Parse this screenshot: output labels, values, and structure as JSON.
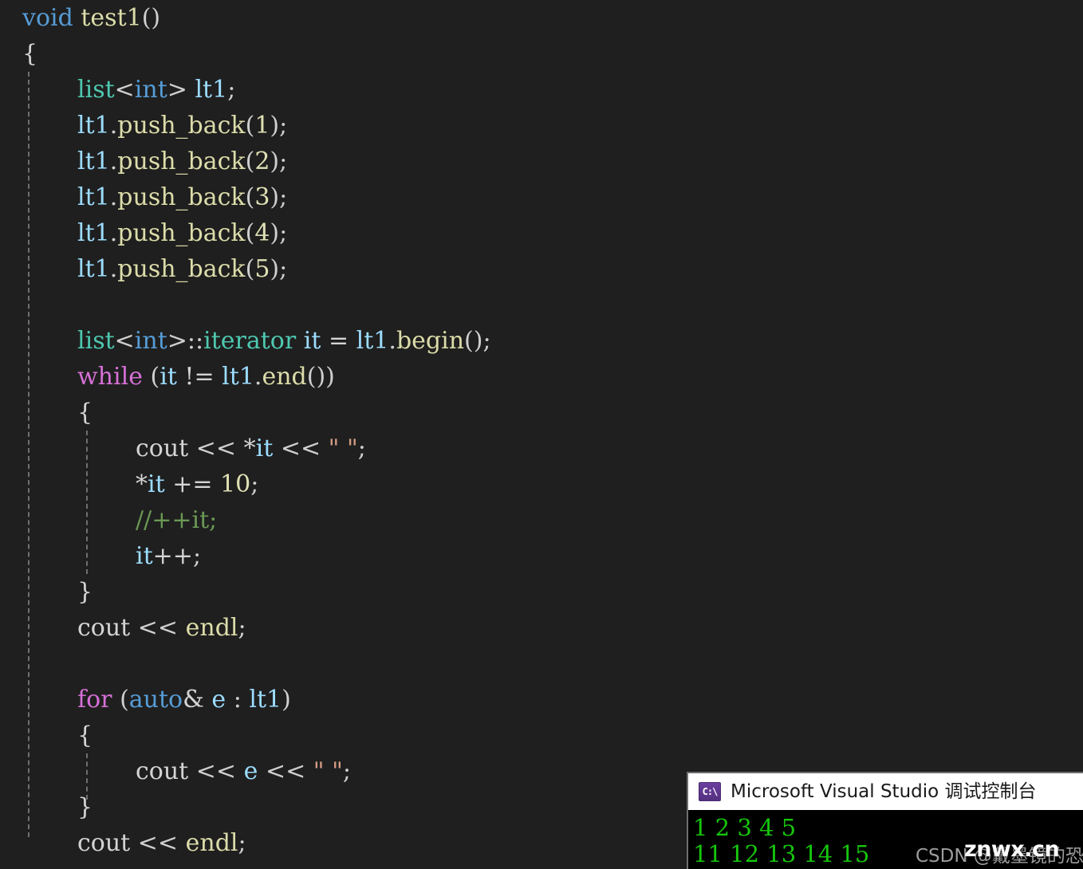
{
  "editor": {
    "background": "#1f1f1f",
    "lines": [
      {
        "indent": 0,
        "tokens": [
          {
            "t": "void",
            "c": "kw"
          },
          {
            "t": " ",
            "c": "plain"
          },
          {
            "t": "test1",
            "c": "fn"
          },
          {
            "t": "()",
            "c": "punct"
          }
        ]
      },
      {
        "indent": 0,
        "tokens": [
          {
            "t": "{",
            "c": "brace"
          }
        ]
      },
      {
        "indent": 1,
        "tokens": [
          {
            "t": "list",
            "c": "type"
          },
          {
            "t": "<",
            "c": "punct"
          },
          {
            "t": "int",
            "c": "kw"
          },
          {
            "t": ">",
            "c": "punct"
          },
          {
            "t": " ",
            "c": "plain"
          },
          {
            "t": "lt1",
            "c": "var"
          },
          {
            "t": ";",
            "c": "punct"
          }
        ]
      },
      {
        "indent": 1,
        "tokens": [
          {
            "t": "lt1",
            "c": "var"
          },
          {
            "t": ".",
            "c": "punct"
          },
          {
            "t": "push_back",
            "c": "fn"
          },
          {
            "t": "(",
            "c": "punct"
          },
          {
            "t": "1",
            "c": "num"
          },
          {
            "t": ")",
            "c": "punct"
          },
          {
            "t": ";",
            "c": "punct"
          }
        ]
      },
      {
        "indent": 1,
        "tokens": [
          {
            "t": "lt1",
            "c": "var"
          },
          {
            "t": ".",
            "c": "punct"
          },
          {
            "t": "push_back",
            "c": "fn"
          },
          {
            "t": "(",
            "c": "punct"
          },
          {
            "t": "2",
            "c": "num"
          },
          {
            "t": ")",
            "c": "punct"
          },
          {
            "t": ";",
            "c": "punct"
          }
        ]
      },
      {
        "indent": 1,
        "tokens": [
          {
            "t": "lt1",
            "c": "var"
          },
          {
            "t": ".",
            "c": "punct"
          },
          {
            "t": "push_back",
            "c": "fn"
          },
          {
            "t": "(",
            "c": "punct"
          },
          {
            "t": "3",
            "c": "num"
          },
          {
            "t": ")",
            "c": "punct"
          },
          {
            "t": ";",
            "c": "punct"
          }
        ]
      },
      {
        "indent": 1,
        "tokens": [
          {
            "t": "lt1",
            "c": "var"
          },
          {
            "t": ".",
            "c": "punct"
          },
          {
            "t": "push_back",
            "c": "fn"
          },
          {
            "t": "(",
            "c": "punct"
          },
          {
            "t": "4",
            "c": "num"
          },
          {
            "t": ")",
            "c": "punct"
          },
          {
            "t": ";",
            "c": "punct"
          }
        ]
      },
      {
        "indent": 1,
        "tokens": [
          {
            "t": "lt1",
            "c": "var"
          },
          {
            "t": ".",
            "c": "punct"
          },
          {
            "t": "push_back",
            "c": "fn"
          },
          {
            "t": "(",
            "c": "punct"
          },
          {
            "t": "5",
            "c": "num"
          },
          {
            "t": ")",
            "c": "punct"
          },
          {
            "t": ";",
            "c": "punct"
          }
        ]
      },
      {
        "indent": 0,
        "tokens": []
      },
      {
        "indent": 1,
        "tokens": [
          {
            "t": "list",
            "c": "type"
          },
          {
            "t": "<",
            "c": "punct"
          },
          {
            "t": "int",
            "c": "kw"
          },
          {
            "t": ">",
            "c": "punct"
          },
          {
            "t": "::",
            "c": "punct"
          },
          {
            "t": "iterator",
            "c": "type"
          },
          {
            "t": " ",
            "c": "plain"
          },
          {
            "t": "it",
            "c": "var"
          },
          {
            "t": " ",
            "c": "plain"
          },
          {
            "t": "=",
            "c": "op"
          },
          {
            "t": " ",
            "c": "plain"
          },
          {
            "t": "lt1",
            "c": "var"
          },
          {
            "t": ".",
            "c": "punct"
          },
          {
            "t": "begin",
            "c": "fn"
          },
          {
            "t": "()",
            "c": "punct"
          },
          {
            "t": ";",
            "c": "punct"
          }
        ]
      },
      {
        "indent": 1,
        "tokens": [
          {
            "t": "while",
            "c": "ctl"
          },
          {
            "t": " ",
            "c": "plain"
          },
          {
            "t": "(",
            "c": "punct"
          },
          {
            "t": "it",
            "c": "var"
          },
          {
            "t": " ",
            "c": "plain"
          },
          {
            "t": "!=",
            "c": "op"
          },
          {
            "t": " ",
            "c": "plain"
          },
          {
            "t": "lt1",
            "c": "var"
          },
          {
            "t": ".",
            "c": "punct"
          },
          {
            "t": "end",
            "c": "fn"
          },
          {
            "t": "())",
            "c": "punct"
          }
        ]
      },
      {
        "indent": 1,
        "tokens": [
          {
            "t": "{",
            "c": "brace"
          }
        ]
      },
      {
        "indent": 2,
        "tokens": [
          {
            "t": "cout",
            "c": "plain"
          },
          {
            "t": " ",
            "c": "plain"
          },
          {
            "t": "<<",
            "c": "punct"
          },
          {
            "t": " ",
            "c": "plain"
          },
          {
            "t": "*",
            "c": "op"
          },
          {
            "t": "it",
            "c": "var"
          },
          {
            "t": " ",
            "c": "plain"
          },
          {
            "t": "<<",
            "c": "punct"
          },
          {
            "t": " ",
            "c": "plain"
          },
          {
            "t": "\" \"",
            "c": "str"
          },
          {
            "t": ";",
            "c": "punct"
          }
        ]
      },
      {
        "indent": 2,
        "tokens": [
          {
            "t": "*",
            "c": "op"
          },
          {
            "t": "it",
            "c": "var"
          },
          {
            "t": " ",
            "c": "plain"
          },
          {
            "t": "+=",
            "c": "op"
          },
          {
            "t": " ",
            "c": "plain"
          },
          {
            "t": "10",
            "c": "num"
          },
          {
            "t": ";",
            "c": "punct"
          }
        ]
      },
      {
        "indent": 2,
        "tokens": [
          {
            "t": "//++it;",
            "c": "cmt"
          }
        ]
      },
      {
        "indent": 2,
        "tokens": [
          {
            "t": "it",
            "c": "var"
          },
          {
            "t": "++",
            "c": "op"
          },
          {
            "t": ";",
            "c": "punct"
          }
        ]
      },
      {
        "indent": 1,
        "tokens": [
          {
            "t": "}",
            "c": "brace"
          }
        ]
      },
      {
        "indent": 1,
        "tokens": [
          {
            "t": "cout",
            "c": "plain"
          },
          {
            "t": " ",
            "c": "plain"
          },
          {
            "t": "<<",
            "c": "punct"
          },
          {
            "t": " ",
            "c": "plain"
          },
          {
            "t": "endl",
            "c": "fn"
          },
          {
            "t": ";",
            "c": "punct"
          }
        ]
      },
      {
        "indent": 0,
        "tokens": []
      },
      {
        "indent": 1,
        "tokens": [
          {
            "t": "for",
            "c": "ctl"
          },
          {
            "t": " ",
            "c": "plain"
          },
          {
            "t": "(",
            "c": "punct"
          },
          {
            "t": "auto",
            "c": "kw"
          },
          {
            "t": "&",
            "c": "op"
          },
          {
            "t": " ",
            "c": "plain"
          },
          {
            "t": "e",
            "c": "var"
          },
          {
            "t": " ",
            "c": "plain"
          },
          {
            "t": ":",
            "c": "punct"
          },
          {
            "t": " ",
            "c": "plain"
          },
          {
            "t": "lt1",
            "c": "var"
          },
          {
            "t": ")",
            "c": "punct"
          }
        ]
      },
      {
        "indent": 1,
        "tokens": [
          {
            "t": "{",
            "c": "brace"
          }
        ]
      },
      {
        "indent": 2,
        "tokens": [
          {
            "t": "cout",
            "c": "plain"
          },
          {
            "t": " ",
            "c": "plain"
          },
          {
            "t": "<<",
            "c": "punct"
          },
          {
            "t": " ",
            "c": "plain"
          },
          {
            "t": "e",
            "c": "var"
          },
          {
            "t": " ",
            "c": "plain"
          },
          {
            "t": "<<",
            "c": "punct"
          },
          {
            "t": " ",
            "c": "plain"
          },
          {
            "t": "\" \"",
            "c": "str"
          },
          {
            "t": ";",
            "c": "punct"
          }
        ]
      },
      {
        "indent": 1,
        "tokens": [
          {
            "t": "}",
            "c": "brace"
          }
        ]
      },
      {
        "indent": 1,
        "tokens": [
          {
            "t": "cout",
            "c": "plain"
          },
          {
            "t": " ",
            "c": "plain"
          },
          {
            "t": "<<",
            "c": "punct"
          },
          {
            "t": " ",
            "c": "plain"
          },
          {
            "t": "endl",
            "c": "fn"
          },
          {
            "t": ";",
            "c": "punct"
          }
        ]
      }
    ]
  },
  "console": {
    "icon_label": "C:\\",
    "title": "Microsoft Visual Studio 调试控制台",
    "text_color": "#16c60c",
    "background": "#000000",
    "output_lines": [
      "1 2 3 4 5",
      "11 12 13 14 15"
    ]
  },
  "watermark": {
    "csdn": "CSDN @戴墨镜的恐龙",
    "site": "znwx.cn"
  }
}
